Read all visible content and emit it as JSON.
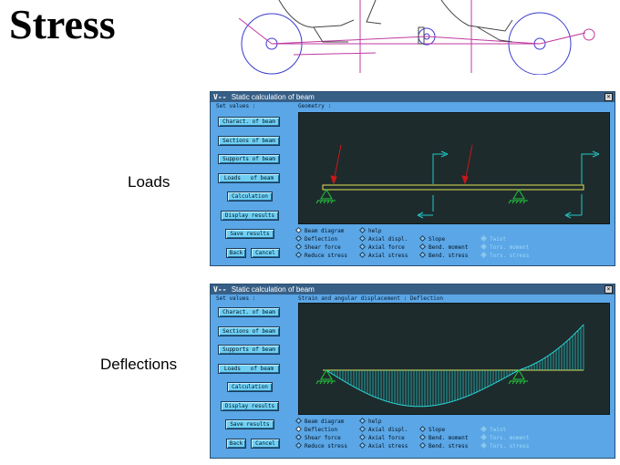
{
  "slide": {
    "title": "Stress",
    "labels": [
      "Loads",
      "Deflections"
    ]
  },
  "windows": [
    {
      "logo": "V--",
      "title": "Static calculation of beam",
      "left_header": "Set values :",
      "canvas_header": "Geometry :",
      "buttons": [
        "Charact. of beam",
        "Sections of beam",
        "Supports of beam",
        "Loads   of beam",
        "Calculation",
        "Display results",
        "Save results",
        "Back",
        "Cancel"
      ],
      "options": [
        {
          "label": "Beam diagram",
          "selected": true,
          "enabled": true
        },
        {
          "label": "help",
          "selected": false,
          "enabled": true
        },
        {
          "label": "Deflection",
          "selected": false,
          "enabled": true
        },
        {
          "label": "Axial displ.",
          "selected": false,
          "enabled": true
        },
        {
          "label": "Slope",
          "selected": false,
          "enabled": true
        },
        {
          "label": "Twist",
          "selected": false,
          "enabled": false
        },
        {
          "label": "Shear force",
          "selected": false,
          "enabled": true
        },
        {
          "label": "Axial force",
          "selected": false,
          "enabled": true
        },
        {
          "label": "Bend. moment",
          "selected": false,
          "enabled": true
        },
        {
          "label": "Tors. moment",
          "selected": false,
          "enabled": false
        },
        {
          "label": "Reduce stress",
          "selected": false,
          "enabled": true
        },
        {
          "label": "Axial stress",
          "selected": false,
          "enabled": true
        },
        {
          "label": "Bend. stress",
          "selected": false,
          "enabled": true
        },
        {
          "label": "Tors. stress",
          "selected": false,
          "enabled": false
        }
      ]
    },
    {
      "logo": "V--",
      "title": "Static calculation of beam",
      "left_header": "Set values :",
      "canvas_header": "Strain and angular displacement : Deflection",
      "buttons": [
        "Charact. of beam",
        "Sections of beam",
        "Supports of beam",
        "Loads   of beam",
        "Calculation",
        "Display results",
        "Save results",
        "Back",
        "Cancel"
      ],
      "options": [
        {
          "label": "Beam diagram",
          "selected": false,
          "enabled": true
        },
        {
          "label": "help",
          "selected": false,
          "enabled": true
        },
        {
          "label": "Deflection",
          "selected": true,
          "enabled": true
        },
        {
          "label": "Axial displ.",
          "selected": false,
          "enabled": true
        },
        {
          "label": "Slope",
          "selected": false,
          "enabled": true
        },
        {
          "label": "Twist",
          "selected": false,
          "enabled": false
        },
        {
          "label": "Shear force",
          "selected": false,
          "enabled": true
        },
        {
          "label": "Axial force",
          "selected": false,
          "enabled": true
        },
        {
          "label": "Bend. moment",
          "selected": false,
          "enabled": true
        },
        {
          "label": "Tors. moment",
          "selected": false,
          "enabled": false
        },
        {
          "label": "Reduce stress",
          "selected": false,
          "enabled": true
        },
        {
          "label": "Axial stress",
          "selected": false,
          "enabled": true
        },
        {
          "label": "Bend. stress",
          "selected": false,
          "enabled": true
        },
        {
          "label": "Tors. stress",
          "selected": false,
          "enabled": false
        }
      ]
    }
  ],
  "colors": {
    "window_bg": "#5aa6e6",
    "titlebar": "#375f86",
    "canvas": "#1e2b2d",
    "beam": "#e2e055",
    "support": "#22c83a",
    "load_arrow": "#c81818",
    "moment_arrow": "#22c8c8",
    "deflection": "#28d6d6"
  }
}
